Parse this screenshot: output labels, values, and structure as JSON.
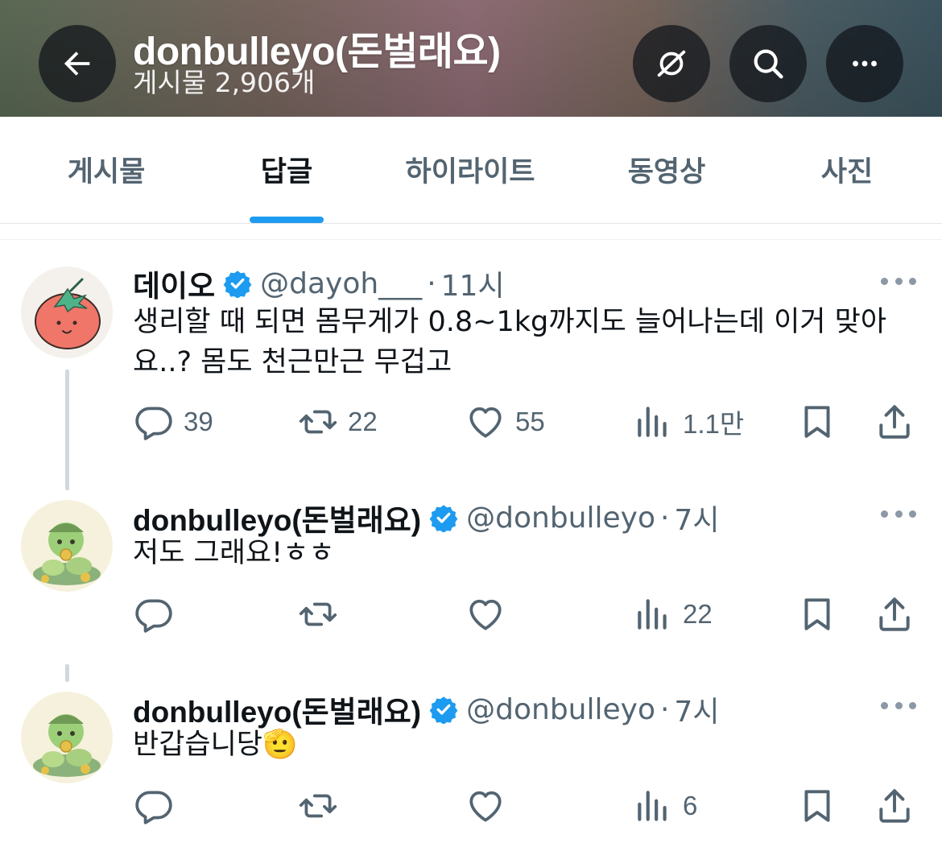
{
  "header": {
    "title": "donbulleyo(돈벌래요)",
    "post_count": "게시물 2,906개",
    "icons": [
      "back-arrow-icon",
      "eye-slash-icon",
      "search-icon",
      "more-icon"
    ]
  },
  "tabs": [
    {
      "label": "게시물"
    },
    {
      "label": "답글"
    },
    {
      "label": "하이라이트"
    },
    {
      "label": "동영상"
    },
    {
      "label": "사진"
    }
  ],
  "active_tab": "답글",
  "colors": {
    "accent": "#1d9bf0",
    "text_primary": "#0f1419",
    "text_secondary": "#536471",
    "verified_badge": "#1d9bf0"
  },
  "tweets": [
    {
      "name": "데이오",
      "handle": "@dayoh___",
      "time": "11시",
      "text": "생리할 때 되면 몸무게가 0.8~1kg까지도 늘어나는데 이거 맞아요..? 몸도 천근만근 무겁고",
      "replies": "39",
      "retweets": "22",
      "likes": "55",
      "views": "1.1만",
      "avatar_icon": "tomato-avatar-icon"
    },
    {
      "name": "donbulleyo(돈벌래요)",
      "handle": "@donbulleyo",
      "time": "7시",
      "text": "저도 그래요!ㅎㅎ",
      "replies": "",
      "retweets": "",
      "likes": "",
      "views": "22",
      "avatar_icon": "caterpillar-avatar-icon"
    },
    {
      "name": "donbulleyo(돈벌래요)",
      "handle": "@donbulleyo",
      "time": "7시",
      "text": "반갑습니당",
      "emoji": "🫡",
      "replies": "",
      "retweets": "",
      "likes": "",
      "views": "6",
      "avatar_icon": "caterpillar-avatar-icon"
    }
  ]
}
